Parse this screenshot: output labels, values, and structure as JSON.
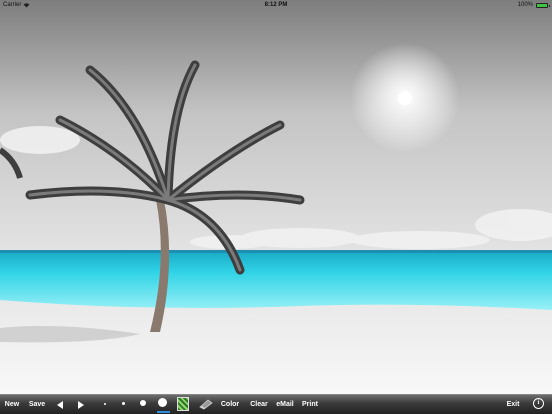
{
  "status_bar": {
    "carrier": "Carrier",
    "time": "8:12 PM",
    "battery_text": "100%",
    "battery_level": 1.0,
    "battery_color": "#3fc43f"
  },
  "canvas": {
    "scene": "beach-photo-partial-color",
    "sea_color": "#2fd3e6"
  },
  "toolbar": {
    "new_label": "New",
    "save_label": "Save",
    "color_label": "Color",
    "clear_label": "Clear",
    "email_label": "eMail",
    "print_label": "Print",
    "exit_label": "Exit",
    "info_label": "i",
    "prev_icon": "left-arrow-icon",
    "next_icon": "right-arrow-icon",
    "selected_tool_color": "#2f8de0"
  }
}
